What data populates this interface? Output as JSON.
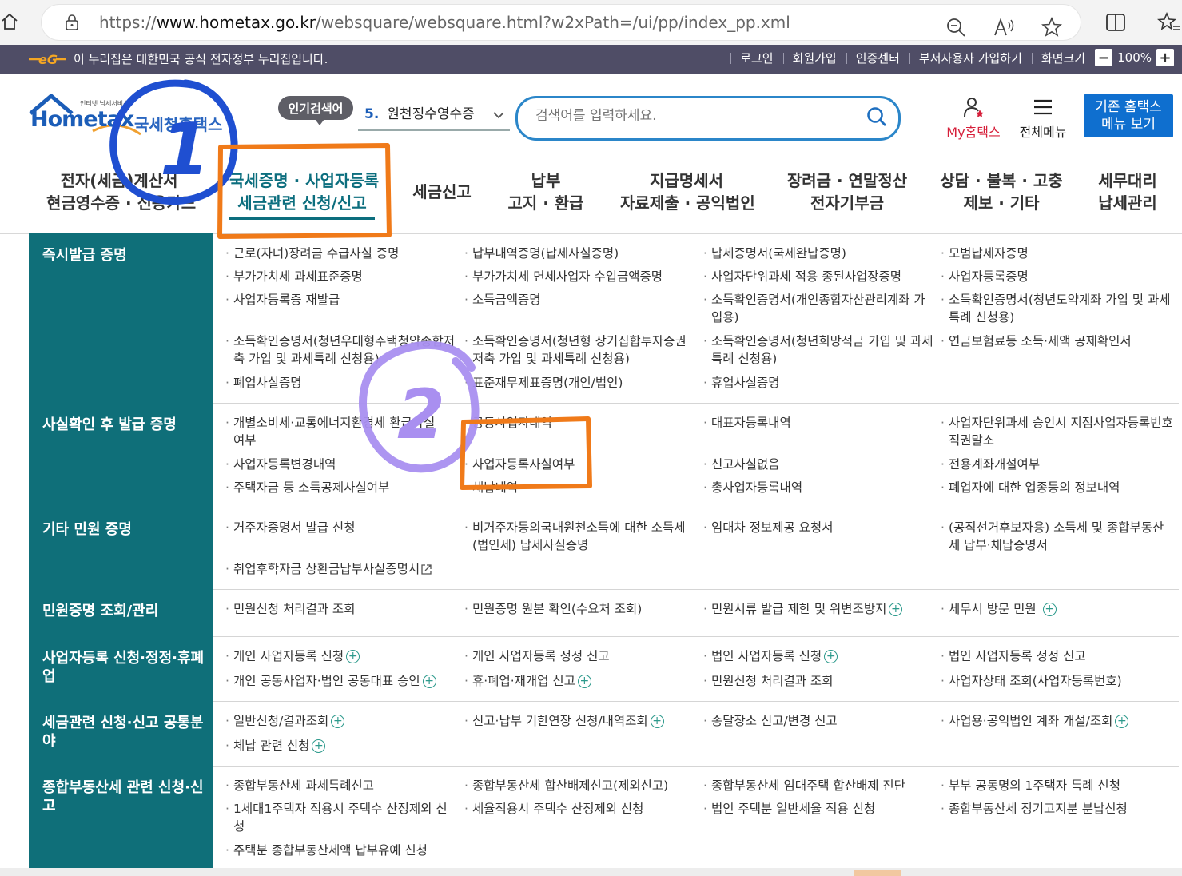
{
  "browser": {
    "url_prefix": "https://",
    "url_domain": "www.hometax.go.kr",
    "url_path": "/websquare/websquare.html?w2xPath=/ui/pp/index_pp.xml"
  },
  "gov_banner": {
    "text": "이 누리집은 대한민국 공식 전자정부 누리집입니다.",
    "links": [
      "로그인",
      "회원가입",
      "인증센터",
      "부서사용자 가입하기",
      "화면크기"
    ],
    "zoom_minus": "−",
    "zoom": "100%",
    "zoom_plus": "+"
  },
  "header": {
    "logo_text": "Hometax",
    "logo_sub": "인터넷 납세서비스",
    "logo_kr": "국세청홈택스",
    "popular_label": "인기검색어",
    "popular_num": "5.",
    "popular_term": "원천징수영수증",
    "search_placeholder": "검색어를 입력하세요.",
    "myhome": "My홈택스",
    "allmenu": "전체메뉴",
    "legacy_line1": "기존 홈택스",
    "legacy_line2": "메뉴 보기"
  },
  "gnb": [
    {
      "l1": "전자(세금)계산서",
      "l2": "현금영수증 · 신용카드"
    },
    {
      "l1": "국세증명 · 사업자등록",
      "l2": "세금관련 신청/신고"
    },
    {
      "l1": "세금신고",
      "l2": ""
    },
    {
      "l1": "납부",
      "l2": "고지 · 환급"
    },
    {
      "l1": "지급명세서",
      "l2": "자료제출 · 공익법인"
    },
    {
      "l1": "장려금 · 연말정산",
      "l2": "전자기부금"
    },
    {
      "l1": "상담 · 불복 · 고충",
      "l2": "제보 · 기타"
    },
    {
      "l1": "세무대리",
      "l2": "납세관리"
    }
  ],
  "rows": [
    {
      "title": "즉시발급 증명",
      "items": [
        [
          "근로(자녀)장려금 수급사실 증명",
          "납부내역증명(납세사실증명)",
          "납세증명서(국세완납증명)",
          "모범납세자증명"
        ],
        [
          "부가가치세 과세표준증명",
          "부가가치세 면세사업자 수입금액증명",
          "사업자단위과세 적용 종된사업장증명",
          "사업자등록증명"
        ],
        [
          "사업자등록증 재발급",
          "소득금액증명",
          "소득확인증명서(개인종합자산관리계좌 가입용)",
          "소득확인증명서(청년도약계좌 가입 및 과세특례 신청용)"
        ],
        [
          "소득확인증명서(청년우대형주택청약종합저축 가입 및 과세특례 신청용)",
          "소득확인증명서(청년형 장기집합투자증권저축 가입 및 과세특례 신청용)",
          "소득확인증명서(청년희망적금 가입 및 과세특례 신청용)",
          "연금보험료등 소득·세액 공제확인서"
        ],
        [
          "폐업사실증명",
          "표준재무제표증명(개인/법인)",
          "휴업사실증명",
          ""
        ]
      ]
    },
    {
      "title": "사실확인 후 발급 증명",
      "items": [
        [
          "개별소비세·교통에너지환경세 환급사실 여부",
          "공동사업자내역",
          "대표자등록내역",
          "사업자단위과세 승인시 지점사업자등록번호 직권말소"
        ],
        [
          "사업자등록변경내역",
          "사업자등록사실여부",
          "신고사실없음",
          "전용계좌개설여부"
        ],
        [
          "주택자금 등 소득공제사실여부",
          "체납내역",
          "총사업자등록내역",
          "폐업자에 대한 업종등의 정보내역"
        ]
      ]
    },
    {
      "title": "기타 민원 증명",
      "items": [
        [
          "거주자증명서 발급 신청",
          "비거주자등의국내원천소득에 대한 소득세(법인세) 납세사실증명",
          "임대차 정보제공 요청서",
          "(공직선거후보자용) 소득세 및 종합부동산세 납부·체납증명서"
        ],
        [
          "취업후학자금 상환금납부사실증명서",
          "",
          "",
          ""
        ]
      ]
    },
    {
      "title": "민원증명 조회/관리",
      "items": [
        [
          "민원신청 처리결과 조회",
          "민원증명 원본 확인(수요처 조회)",
          "민원서류 발급 제한 및 위변조방지",
          "세무서 방문 민원"
        ]
      ]
    },
    {
      "title": "사업자등록 신청·정정·휴폐업",
      "items": [
        [
          "개인 사업자등록 신청",
          "개인 사업자등록 정정 신고",
          "법인 사업자등록 신청",
          "법인 사업자등록 정정 신고"
        ],
        [
          "개인 공동사업자·법인 공동대표 승인",
          "휴·폐업·재개업 신고",
          "민원신청 처리결과 조회",
          "사업자상태 조회(사업자등록번호)"
        ]
      ]
    },
    {
      "title": "세금관련 신청·신고 공통분야",
      "items": [
        [
          "일반신청/결과조회",
          "신고·납부 기한연장 신청/내역조회",
          "송달장소 신고/변경 신고",
          "사업용·공익법인 계좌 개설/조회"
        ],
        [
          "체납 관련 신청",
          "",
          "",
          ""
        ]
      ]
    },
    {
      "title": "종합부동산세 관련 신청·신고",
      "items": [
        [
          "종합부동산세 과세특례신고",
          "종합부동산세 합산배제신고(제외신고)",
          "종합부동산세 임대주택 합산배제 진단",
          "부부 공동명의 1주택자 특례 신청"
        ],
        [
          "1세대1주택자 적용시 주택수 산정제외 신청",
          "세율적용시 주택수 산정제외 신청",
          "법인 주택분 일반세율 적용 신청",
          "종합부동산세 정기고지분 분납신청"
        ],
        [
          "주택분 종합부동산세액 납부유예 신청",
          "",
          "",
          ""
        ]
      ]
    }
  ],
  "annotations": [
    "1",
    "2"
  ],
  "colors": {
    "teal": "#0f6f79",
    "orange": "#f07a19",
    "purple": "#a98ff0",
    "blue_annotation": "#1f4fd1"
  }
}
